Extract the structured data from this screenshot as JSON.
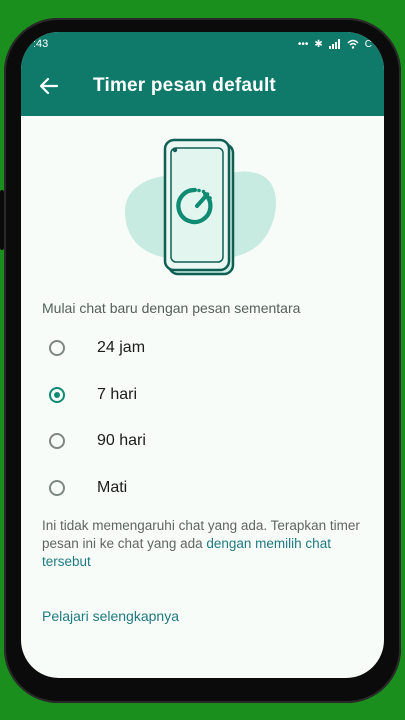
{
  "status_bar": {
    "time": ":43",
    "battery": "C"
  },
  "app_bar": {
    "title": "Timer pesan default"
  },
  "section_label": "Mulai chat baru dengan pesan sementara",
  "options": [
    {
      "label": "24 jam",
      "selected": false
    },
    {
      "label": "7 hari",
      "selected": true
    },
    {
      "label": "90 hari",
      "selected": false
    },
    {
      "label": "Mati",
      "selected": false
    }
  ],
  "info": {
    "text": "Ini tidak memengaruhi chat yang ada. Terapkan timer pesan ini ke chat yang ada ",
    "link": "dengan memilih chat tersebut"
  },
  "learn_more": "Pelajari selengkapnya",
  "colors": {
    "background": "#1a8f1e",
    "app_bar": "#0f7a6a",
    "accent": "#0f8a73",
    "link": "#1f7a82",
    "illustration_blob": "#c8ebe1"
  },
  "icons": [
    "back-arrow-icon",
    "timer-icon",
    "bluetooth-icon",
    "wifi-icon",
    "signal-icon",
    "battery-icon"
  ]
}
